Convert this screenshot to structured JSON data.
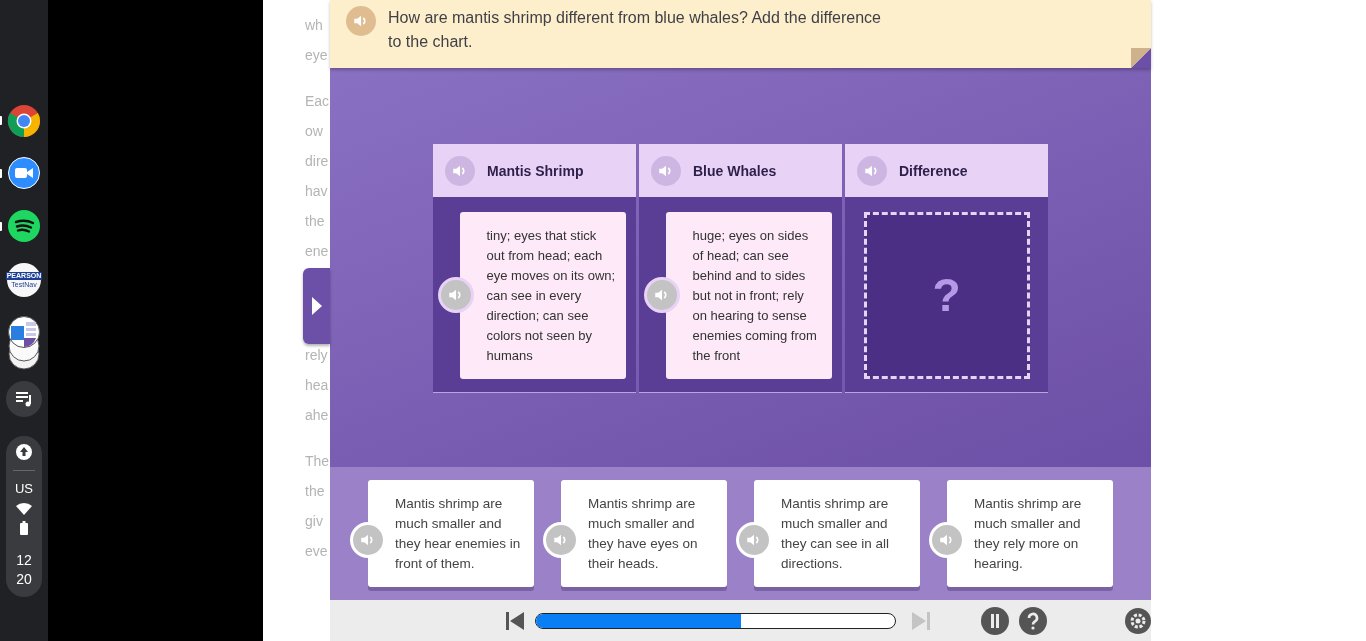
{
  "shelf": {
    "apps": [
      {
        "kind": "chrome",
        "running": true
      },
      {
        "kind": "video",
        "running": true
      },
      {
        "kind": "music",
        "running": true
      },
      {
        "kind": "brand",
        "running": false,
        "logo_top": "PEARSON",
        "logo_bottom": "TestNav"
      },
      {
        "kind": "windows",
        "running": false
      }
    ],
    "tray": {
      "keyboard": "US",
      "hour": "12",
      "minute": "20"
    }
  },
  "article": {
    "paragraphs": [
      [
        "wh",
        "eye"
      ],
      [
        "Eac",
        "ow",
        "dire",
        "hav",
        "the",
        "ene"
      ],
      [
        "rely",
        "hea",
        "ahe"
      ],
      [
        "The",
        "the",
        "giv",
        "eve"
      ]
    ]
  },
  "activity": {
    "prompt": "How are mantis shrimp different from blue whales? Add the difference to the chart.",
    "chart": {
      "columns": [
        {
          "title": "Mantis Shrimp",
          "kind": "card",
          "text": "tiny; eyes that stick out from head; each eye moves on its own; can see in every direction; can see colors not seen by humans"
        },
        {
          "title": "Blue Whales",
          "kind": "card",
          "text": "huge; eyes on sides of head; can see behind and to sides but not in front; rely on hearing to sense enemies coming from the front"
        },
        {
          "title": "Difference",
          "kind": "drop",
          "text": "?"
        }
      ]
    },
    "choices": [
      "Mantis shrimp are much smaller and they hear enemies in front of them.",
      "Mantis shrimp are much smaller and they have eyes on their heads.",
      "Mantis shrimp are much smaller and they can see in all directions.",
      "Mantis shrimp are much smaller and they rely more on hearing."
    ],
    "footer": {
      "progress": {
        "level": 0.57
      },
      "previous_disabled": false,
      "next_disabled": true
    }
  }
}
